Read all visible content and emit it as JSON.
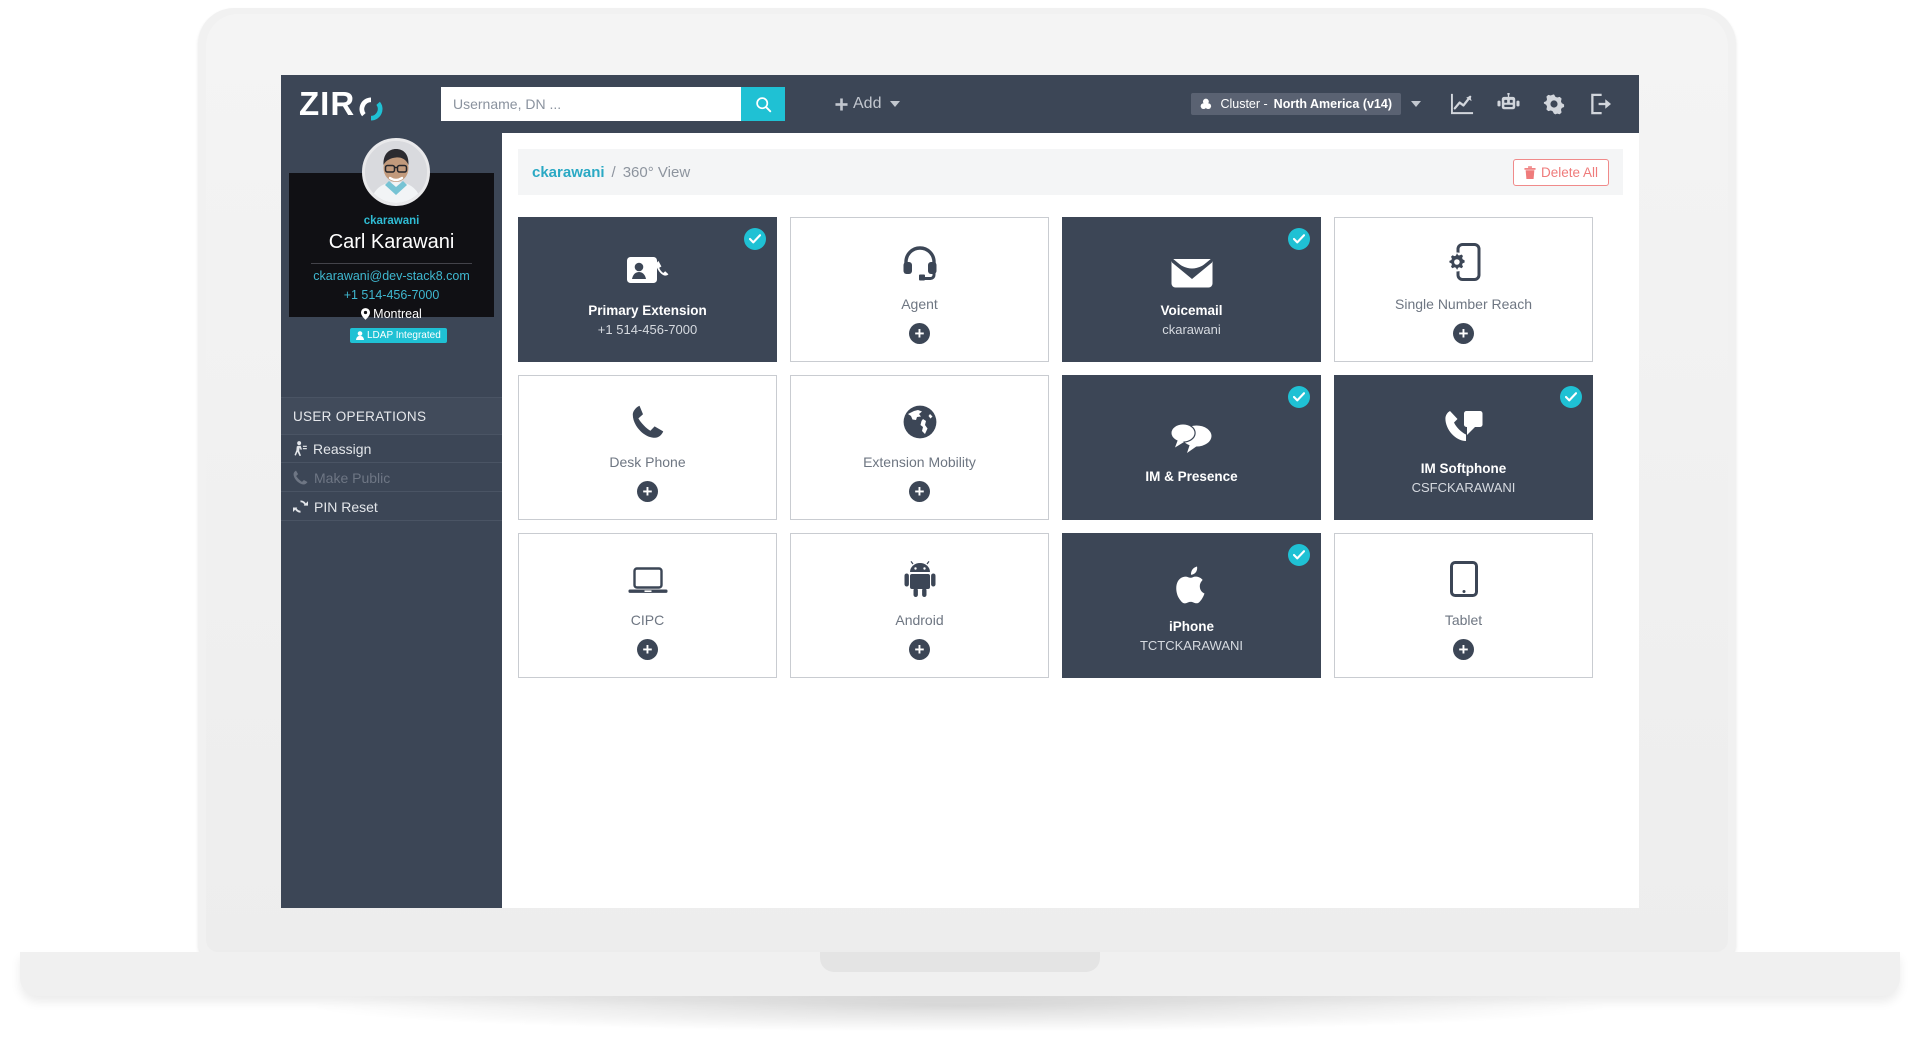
{
  "app": {
    "brand": "ZIR",
    "brand_icon": "ziro-o-logo"
  },
  "topbar": {
    "search_placeholder": "Username, DN ...",
    "search_value": "",
    "search_icon": "search-icon",
    "add_label": "Add",
    "add_icon": "plus-icon",
    "cluster_icon": "sitemap-icon",
    "cluster_prefix": "Cluster - ",
    "cluster_name": "North America (v14)",
    "icons": {
      "analytics": "chart-line-icon",
      "bot": "robot-icon",
      "settings": "gear-icon",
      "logout": "sign-out-icon"
    }
  },
  "sidebar": {
    "profile": {
      "avatar": "user-avatar-photo",
      "username": "ckarawani",
      "fullname": "Carl Karawani",
      "email": "ckarawani@dev-stack8.com",
      "phone": "+1 514-456-7000",
      "location": "Montreal",
      "location_icon": "map-marker-icon",
      "tag": "LDAP Integrated",
      "tag_icon": "user-icon"
    },
    "operations_header": "USER OPERATIONS",
    "operations": [
      {
        "label": "Reassign",
        "icon": "walking-icon",
        "disabled": false
      },
      {
        "label": "Make Public",
        "icon": "phone-icon",
        "disabled": true
      },
      {
        "label": "PIN Reset",
        "icon": "refresh-icon",
        "disabled": false
      }
    ]
  },
  "content": {
    "breadcrumb_user": "ckarawani",
    "breadcrumb_separator": "/",
    "breadcrumb_page": "360° View",
    "delete_all_label": "Delete All",
    "delete_all_icon": "trash-icon",
    "cards": [
      {
        "title": "Primary Extension",
        "subtitle": "+1 514-456-7000",
        "icon": "address-card-phone-icon",
        "active": true,
        "add": false
      },
      {
        "title": "Agent",
        "subtitle": "",
        "icon": "headset-icon",
        "active": false,
        "add": true
      },
      {
        "title": "Voicemail",
        "subtitle": "ckarawani",
        "icon": "envelope-icon",
        "active": true,
        "add": false
      },
      {
        "title": "Single Number Reach",
        "subtitle": "",
        "icon": "mobile-gear-icon",
        "active": false,
        "add": true
      },
      {
        "title": "Desk Phone",
        "subtitle": "",
        "icon": "phone-icon",
        "active": false,
        "add": true
      },
      {
        "title": "Extension Mobility",
        "subtitle": "",
        "icon": "globe-icon",
        "active": false,
        "add": true
      },
      {
        "title": "IM & Presence",
        "subtitle": "",
        "icon": "comments-icon",
        "active": true,
        "add": false
      },
      {
        "title": "IM Softphone",
        "subtitle": "CSFCKARAWANI",
        "icon": "phone-square-icon",
        "active": true,
        "add": false
      },
      {
        "title": "CIPC",
        "subtitle": "",
        "icon": "laptop-icon",
        "active": false,
        "add": true
      },
      {
        "title": "Android",
        "subtitle": "",
        "icon": "android-icon",
        "active": false,
        "add": true
      },
      {
        "title": "iPhone",
        "subtitle": "TCTCKARAWANI",
        "icon": "apple-icon",
        "active": true,
        "add": false
      },
      {
        "title": "Tablet",
        "subtitle": "",
        "icon": "tablet-icon",
        "active": false,
        "add": true
      }
    ],
    "add_icon": "plus-circle-icon",
    "check_icon": "check-icon"
  },
  "colors": {
    "accent_teal": "#1fc1d4",
    "dark_navy": "#3c4656",
    "danger": "#ef7b7b",
    "link_blue": "#2aa9c4"
  }
}
